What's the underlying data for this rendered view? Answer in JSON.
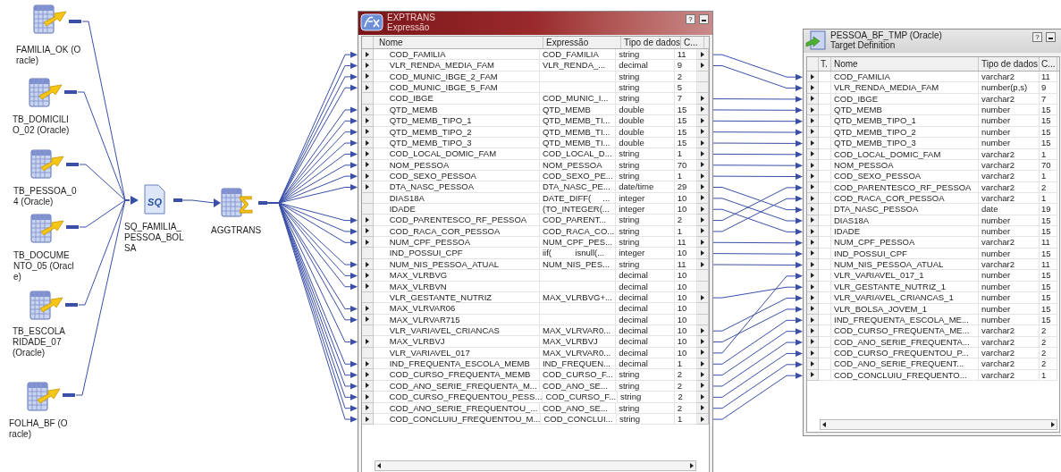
{
  "sources": [
    {
      "label": "FAMILIA_OK (Oracle)"
    },
    {
      "label": "TB_DOMICILIO_02 (Oracle)"
    },
    {
      "label": "TB_PESSOA_04 (Oracle)"
    },
    {
      "label": "TB_DOCUMENTO_05 (Oracle)"
    },
    {
      "label": "TB_ESCOLARIDADE_07 (Oracle)"
    },
    {
      "label": "FOLHA_BF (Oracle)"
    }
  ],
  "source_qualifier": {
    "label": "SQ_FAMILIA_PESSOA_BOLSA",
    "icon_text": "SQ"
  },
  "aggregator": {
    "label": "AGGTRANS",
    "icon_symbol": "Σ"
  },
  "exptrans": {
    "title": "EXPTRANS",
    "subtitle": "Expressão",
    "help": "?",
    "columns": [
      "Nome",
      "Expressão",
      "Tipo de dados",
      "C..."
    ],
    "rows": [
      {
        "name": "COD_FAMILIA",
        "expression": "COD_FAMILIA",
        "type": "string",
        "c": "11",
        "input": true,
        "output": true
      },
      {
        "name": "VLR_RENDA_MEDIA_FAM",
        "expression": "VLR_RENDA_...",
        "type": "decimal",
        "c": "9",
        "input": true,
        "output": true
      },
      {
        "name": "COD_MUNIC_IBGE_2_FAM",
        "type": "string",
        "c": "2",
        "input": true,
        "output": false
      },
      {
        "name": "COD_MUNIC_IBGE_5_FAM",
        "type": "string",
        "c": "5",
        "input": true,
        "output": false
      },
      {
        "name": "COD_IBGE",
        "expression": "COD_MUNIC_I...",
        "type": "string",
        "c": "7",
        "input": false,
        "output": true
      },
      {
        "name": "QTD_MEMB",
        "expression": "QTD_MEMB",
        "type": "double",
        "c": "15",
        "input": true,
        "output": true
      },
      {
        "name": "QTD_MEMB_TIPO_1",
        "expression": "QTD_MEMB_TI...",
        "type": "double",
        "c": "15",
        "input": true,
        "output": true
      },
      {
        "name": "QTD_MEMB_TIPO_2",
        "expression": "QTD_MEMB_TI...",
        "type": "double",
        "c": "15",
        "input": true,
        "output": true
      },
      {
        "name": "QTD_MEMB_TIPO_3",
        "expression": "QTD_MEMB_TI...",
        "type": "double",
        "c": "15",
        "input": true,
        "output": true
      },
      {
        "name": "COD_LOCAL_DOMIC_FAM",
        "expression": "COD_LOCAL_D...",
        "type": "string",
        "c": "1",
        "input": true,
        "output": true
      },
      {
        "name": "NOM_PESSOA",
        "expression": "NOM_PESSOA",
        "type": "string",
        "c": "70",
        "input": true,
        "output": true
      },
      {
        "name": "COD_SEXO_PESSOA",
        "expression": "COD_SEXO_PE...",
        "type": "string",
        "c": "1",
        "input": true,
        "output": true
      },
      {
        "name": "DTA_NASC_PESSOA",
        "expression": "DTA_NASC_PE...",
        "type": "date/time",
        "c": "29",
        "input": true,
        "output": true
      },
      {
        "name": "DIAS18A",
        "expression": "DATE_DIFF(     ...",
        "type": "integer",
        "c": "10",
        "input": false,
        "output": true
      },
      {
        "name": "IDADE",
        "expression": "(TO_INTEGER(...",
        "type": "integer",
        "c": "10",
        "input": false,
        "output": true
      },
      {
        "name": "COD_PARENTESCO_RF_PESSOA",
        "expression": "COD_PARENT...",
        "type": "string",
        "c": "2",
        "input": true,
        "output": true
      },
      {
        "name": "COD_RACA_COR_PESSOA",
        "expression": "COD_RACA_CO...",
        "type": "string",
        "c": "1",
        "input": true,
        "output": true
      },
      {
        "name": "NUM_CPF_PESSOA",
        "expression": "NUM_CPF_PES...",
        "type": "string",
        "c": "11",
        "input": true,
        "output": true
      },
      {
        "name": "IND_POSSUI_CPF",
        "expression": "iif(          isnull(...",
        "type": "integer",
        "c": "10",
        "input": false,
        "output": true
      },
      {
        "name": "NUM_NIS_PESSOA_ATUAL",
        "expression": "NUM_NIS_PES...",
        "type": "string",
        "c": "11",
        "input": true,
        "output": true
      },
      {
        "name": "MAX_VLRBVG",
        "type": "decimal",
        "c": "10",
        "input": true,
        "output": false
      },
      {
        "name": "MAX_VLRBVN",
        "type": "decimal",
        "c": "10",
        "input": true,
        "output": false
      },
      {
        "name": "VLR_GESTANTE_NUTRIZ",
        "expression": "MAX_VLRBVG+...",
        "type": "decimal",
        "c": "10",
        "input": false,
        "output": true
      },
      {
        "name": "MAX_VLRVAR06",
        "type": "decimal",
        "c": "10",
        "input": true,
        "output": false
      },
      {
        "name": "MAX_VLRVAR715",
        "type": "decimal",
        "c": "10",
        "input": true,
        "output": false
      },
      {
        "name": "VLR_VARIAVEL_CRIANCAS",
        "expression": "MAX_VLRVAR0...",
        "type": "decimal",
        "c": "10",
        "input": false,
        "output": true
      },
      {
        "name": "MAX_VLRBVJ",
        "expression": "MAX_VLRBVJ",
        "type": "decimal",
        "c": "10",
        "input": true,
        "output": true
      },
      {
        "name": "VLR_VARIAVEL_017",
        "expression": "MAX_VLRVAR0...",
        "type": "decimal",
        "c": "10",
        "input": false,
        "output": true
      },
      {
        "name": "IND_FREQUENTA_ESCOLA_MEMB",
        "expression": "IND_FREQUEN...",
        "type": "decimal",
        "c": "1",
        "input": true,
        "output": true
      },
      {
        "name": "COD_CURSO_FREQUENTA_MEMB",
        "expression": "COD_CURSO_F...",
        "type": "string",
        "c": "2",
        "input": true,
        "output": true
      },
      {
        "name": "COD_ANO_SERIE_FREQUENTA_M...",
        "expression": "COD_ANO_SE...",
        "type": "string",
        "c": "2",
        "input": true,
        "output": true
      },
      {
        "name": "COD_CURSO_FREQUENTOU_PESS...",
        "expression": "COD_CURSO_F...",
        "type": "string",
        "c": "2",
        "input": true,
        "output": true
      },
      {
        "name": "COD_ANO_SERIE_FREQUENTOU_...",
        "expression": "COD_ANO_SE...",
        "type": "string",
        "c": "2",
        "input": true,
        "output": true
      },
      {
        "name": "COD_CONCLUIU_FREQUENTOU_M...",
        "expression": "COD_CONCLUI...",
        "type": "string",
        "c": "1",
        "input": true,
        "output": true
      }
    ]
  },
  "target": {
    "title": "PESSOA_BF_TMP (Oracle)",
    "subtitle": "Target Definition",
    "help": "?",
    "columns": [
      "T.",
      "Nome",
      "Tipo de dados",
      "C..."
    ],
    "rows": [
      {
        "name": "COD_FAMILIA",
        "type": "varchar2",
        "c": "11"
      },
      {
        "name": "VLR_RENDA_MEDIA_FAM",
        "type": "number(p,s)",
        "c": "9"
      },
      {
        "name": "COD_IBGE",
        "type": "varchar2",
        "c": "7"
      },
      {
        "name": "QTD_MEMB",
        "type": "number",
        "c": "15"
      },
      {
        "name": "QTD_MEMB_TIPO_1",
        "type": "number",
        "c": "15"
      },
      {
        "name": "QTD_MEMB_TIPO_2",
        "type": "number",
        "c": "15"
      },
      {
        "name": "QTD_MEMB_TIPO_3",
        "type": "number",
        "c": "15"
      },
      {
        "name": "COD_LOCAL_DOMIC_FAM",
        "type": "varchar2",
        "c": "1"
      },
      {
        "name": "NOM_PESSOA",
        "type": "varchar2",
        "c": "70"
      },
      {
        "name": "COD_SEXO_PESSOA",
        "type": "varchar2",
        "c": "1"
      },
      {
        "name": "COD_PARENTESCO_RF_PESSOA",
        "type": "varchar2",
        "c": "2"
      },
      {
        "name": "COD_RACA_COR_PESSOA",
        "type": "varchar2",
        "c": "1"
      },
      {
        "name": "DTA_NASC_PESSOA",
        "type": "date",
        "c": "19"
      },
      {
        "name": "DIAS18A",
        "type": "number",
        "c": "15"
      },
      {
        "name": "IDADE",
        "type": "number",
        "c": "15"
      },
      {
        "name": "NUM_CPF_PESSOA",
        "type": "varchar2",
        "c": "11"
      },
      {
        "name": "IND_POSSUI_CPF",
        "type": "number",
        "c": "15"
      },
      {
        "name": "NUM_NIS_PESSOA_ATUAL",
        "type": "varchar2",
        "c": "11"
      },
      {
        "name": "VLR_VARIAVEL_017_1",
        "type": "number",
        "c": "15"
      },
      {
        "name": "VLR_GESTANTE_NUTRIZ_1",
        "type": "number",
        "c": "15"
      },
      {
        "name": "VLR_VARIAVEL_CRIANCAS_1",
        "type": "number",
        "c": "15"
      },
      {
        "name": "VLR_BOLSA_JOVEM_1",
        "type": "number",
        "c": "15"
      },
      {
        "name": "IND_FREQUENTA_ESCOLA_ME...",
        "type": "number",
        "c": "15"
      },
      {
        "name": "COD_CURSO_FREQUENTA_ME...",
        "type": "varchar2",
        "c": "2"
      },
      {
        "name": "COD_ANO_SERIE_FREQUENTA...",
        "type": "varchar2",
        "c": "2"
      },
      {
        "name": "COD_CURSO_FREQUENTOU_P...",
        "type": "varchar2",
        "c": "2"
      },
      {
        "name": "COD_ANO_SERIE_FREQUENT...",
        "type": "varchar2",
        "c": "2"
      },
      {
        "name": "COD_CONCLUIU_FREQUENTO...",
        "type": "varchar2",
        "c": "1"
      }
    ]
  }
}
